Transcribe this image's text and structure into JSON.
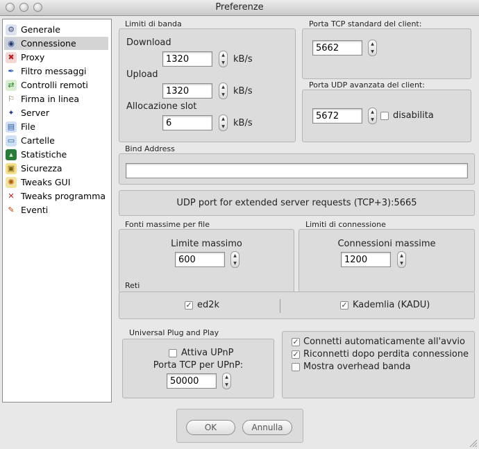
{
  "window": {
    "title": "Preferenze"
  },
  "sidebar": {
    "items": [
      {
        "label": "Generale",
        "icon": "gear-icon"
      },
      {
        "label": "Connessione",
        "icon": "network-icon"
      },
      {
        "label": "Proxy",
        "icon": "proxy-icon"
      },
      {
        "label": "Filtro messaggi",
        "icon": "quill-icon"
      },
      {
        "label": "Controlli remoti",
        "icon": "remote-icon"
      },
      {
        "label": "Firma in linea",
        "icon": "signpost-icon"
      },
      {
        "label": "Server",
        "icon": "server-icon"
      },
      {
        "label": "File",
        "icon": "file-icon"
      },
      {
        "label": "Cartelle",
        "icon": "folder-icon"
      },
      {
        "label": "Statistiche",
        "icon": "chart-icon"
      },
      {
        "label": "Sicurezza",
        "icon": "lock-icon"
      },
      {
        "label": "Tweaks GUI",
        "icon": "palette-icon"
      },
      {
        "label": "Tweaks programma",
        "icon": "tools-icon"
      },
      {
        "label": "Eventi",
        "icon": "events-icon"
      }
    ]
  },
  "bandwidth": {
    "legend": "Limiti di banda",
    "download_label": "Download",
    "download_value": "1320",
    "upload_label": "Upload",
    "upload_value": "1320",
    "slot_label": "Allocazione slot",
    "slot_value": "6",
    "unit": "kB/s"
  },
  "tcp": {
    "legend": "Porta TCP standard del client:",
    "value": "5662"
  },
  "udp": {
    "legend": "Porta UDP avanzata del client:",
    "value": "5672",
    "disable_label": "disabilita",
    "disable_checked": false
  },
  "bind": {
    "legend": "Bind Address",
    "value": ""
  },
  "udp_server": {
    "text": "UDP port for extended server requests (TCP+3):5665"
  },
  "sources": {
    "legend": "Fonti massime per file",
    "label": "Limite massimo",
    "value": "600"
  },
  "conn": {
    "legend": "Limiti di connessione",
    "label": "Connessioni massime",
    "value": "1200"
  },
  "networks": {
    "legend": "Reti",
    "ed2k_label": "ed2k",
    "ed2k_checked": true,
    "kad_label": "Kademlia (KADU)",
    "kad_checked": true
  },
  "upnp": {
    "legend": "Universal Plug and Play",
    "enable_label": "Attiva UPnP",
    "enable_checked": false,
    "port_label": "Porta TCP per UPnP:",
    "port_value": "50000"
  },
  "options": [
    {
      "label": "Connetti automaticamente all'avvio",
      "checked": true
    },
    {
      "label": "Riconnetti dopo perdita connessione",
      "checked": true
    },
    {
      "label": "Mostra overhead banda",
      "checked": false
    }
  ],
  "buttons": {
    "ok": "OK",
    "cancel": "Annulla"
  },
  "colors": {
    "selected_row": "#d4d4d4",
    "panel": "#dcdcdc",
    "window": "#e8e8e8"
  }
}
